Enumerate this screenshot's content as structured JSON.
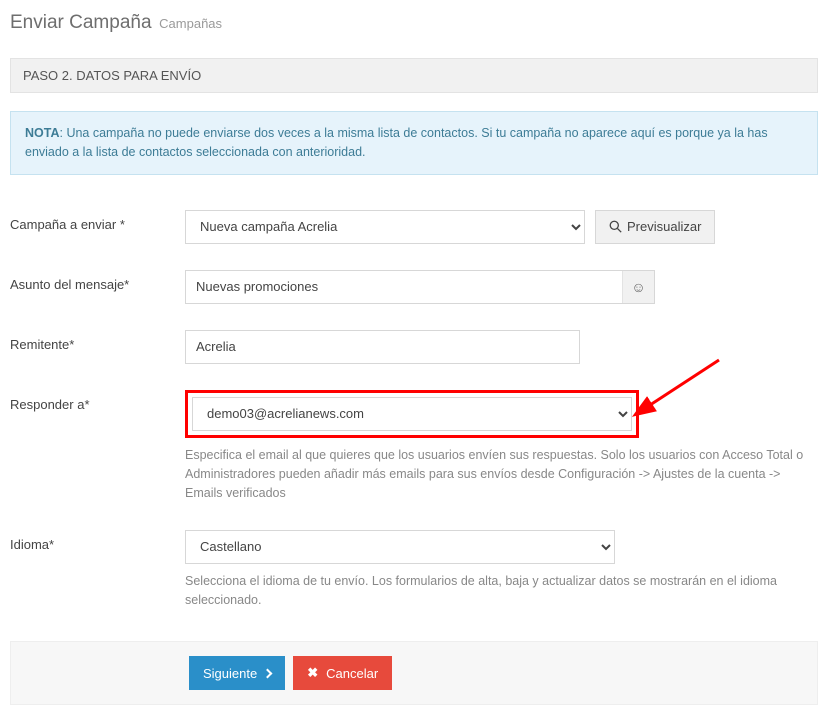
{
  "header": {
    "title": "Enviar Campaña",
    "subtitle": "Campañas"
  },
  "section_title": "PASO 2. DATOS PARA ENVÍO",
  "note": {
    "label": "NOTA",
    "text": ": Una campaña no puede enviarse dos veces a la misma lista de contactos. Si tu campaña no aparece aquí es porque ya la has enviado a la lista de contactos seleccionada con anterioridad."
  },
  "fields": {
    "campaign": {
      "label": "Campaña a enviar *",
      "value": "Nueva campaña Acrelia",
      "preview_btn": "Previsualizar"
    },
    "subject": {
      "label": "Asunto del mensaje*",
      "value": "Nuevas promociones"
    },
    "sender": {
      "label": "Remitente*",
      "value": "Acrelia"
    },
    "reply_to": {
      "label": "Responder a*",
      "value": "demo03@acrelianews.com",
      "help": "Especifica el email al que quieres que los usuarios envíen sus respuestas. Solo los usuarios con Acceso Total o Administradores pueden añadir más emails para sus envíos desde Configuración -> Ajustes de la cuenta -> Emails verificados"
    },
    "language": {
      "label": "Idioma*",
      "value": "Castellano",
      "help": "Selecciona el idioma de tu envío. Los formularios de alta, baja y actualizar datos se mostrarán en el idioma seleccionado."
    }
  },
  "footer": {
    "next": "Siguiente",
    "cancel": "Cancelar"
  }
}
